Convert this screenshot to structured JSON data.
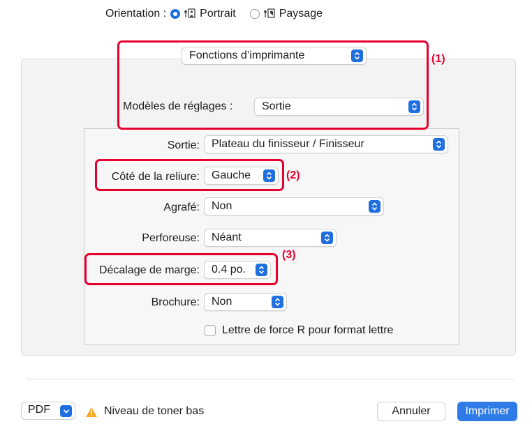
{
  "orientation": {
    "label": "Orientation :",
    "options": [
      {
        "label": "Portrait",
        "selected": true
      },
      {
        "label": "Paysage",
        "selected": false
      }
    ]
  },
  "section_popup": {
    "value": "Fonctions d’imprimante"
  },
  "preset": {
    "label": "Modèles de réglages :",
    "value": "Sortie"
  },
  "fields": [
    {
      "label": "Sortie:",
      "value": "Plateau du finisseur / Finisseur"
    },
    {
      "label": "Côté de la reliure:",
      "value": "Gauche"
    },
    {
      "label": "Agrafé:",
      "value": "Non"
    },
    {
      "label": "Perforeuse:",
      "value": "Néant"
    },
    {
      "label": "Décalage de marge:",
      "value": "0.4 po."
    },
    {
      "label": "Brochure:",
      "value": "Non"
    }
  ],
  "checkbox": {
    "label": "Lettre de force R pour format lettre",
    "checked": false
  },
  "callouts": [
    "(1)",
    "(2)",
    "(3)"
  ],
  "footer": {
    "pdf_label": "PDF",
    "warning_text": "Niveau de toner bas",
    "cancel_label": "Annuler",
    "print_label": "Imprimer"
  },
  "colors": {
    "accent": "#1f6fe0",
    "annotation": "#e5002d",
    "warning": "#f5a623"
  }
}
